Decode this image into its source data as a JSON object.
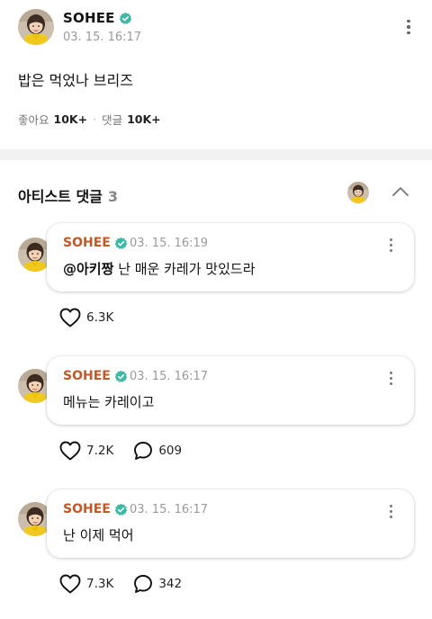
{
  "post": {
    "author": "SOHEE",
    "date": "03. 15. 16:17",
    "body": "밥은 먹었나 브리즈",
    "likes_label": "좋아요",
    "likes_count": "10K+",
    "comments_label": "댓글",
    "comments_count": "10K+",
    "separator": "·"
  },
  "section": {
    "title": "아티스트 댓글",
    "count": "3"
  },
  "comments": [
    {
      "author": "SOHEE",
      "date": "03. 15. 16:19",
      "mention": "@아키짱",
      "text": "난 매운 카레가 맛있드라",
      "likes": "6.3K",
      "replies": ""
    },
    {
      "author": "SOHEE",
      "date": "03. 15. 16:17",
      "mention": "",
      "text": "메뉴는 카레이고",
      "likes": "7.2K",
      "replies": "609"
    },
    {
      "author": "SOHEE",
      "date": "03. 15. 16:17",
      "mention": "",
      "text": "난 이제 먹어",
      "likes": "7.3K",
      "replies": "342"
    }
  ],
  "colors": {
    "accent_name": "#c0582a",
    "verified": "#3fb8a8",
    "divider": "#f2f2f2",
    "muted": "#9a9a9a"
  },
  "icons": [
    "verified-badge-icon",
    "kebab-menu-icon",
    "chevron-up-icon",
    "heart-icon",
    "comment-bubble-icon"
  ]
}
